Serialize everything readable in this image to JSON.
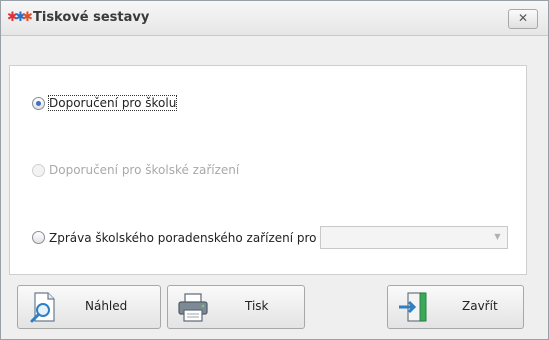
{
  "window": {
    "title": "Tiskové sestavy",
    "close_symbol": "✕",
    "app_icon": "people-group-icon"
  },
  "options": [
    {
      "label": "Doporučení pro školu",
      "checked": true,
      "enabled": true
    },
    {
      "label": "Doporučení pro školské zařízení",
      "checked": false,
      "enabled": false
    },
    {
      "label": "Zpráva školského poradenského zařízení pro",
      "checked": false,
      "enabled": true
    }
  ],
  "combo": {
    "value": "",
    "arrow": "▼"
  },
  "buttons": {
    "preview": {
      "label": "Náhled",
      "icon": "preview-magnifier-icon"
    },
    "print": {
      "label": "Tisk",
      "icon": "printer-icon"
    },
    "close": {
      "label": "Zavřít",
      "icon": "exit-door-icon"
    }
  }
}
